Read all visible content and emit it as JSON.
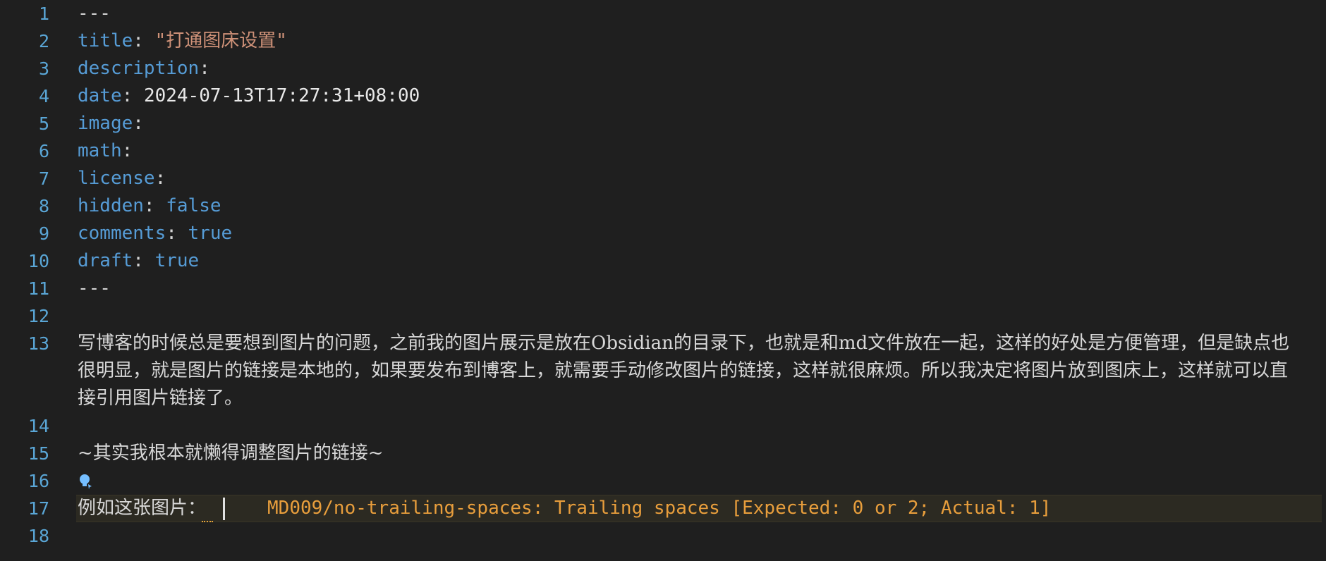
{
  "lines": [
    {
      "n": "1",
      "dash": "---"
    },
    {
      "n": "2",
      "key": "title",
      "value": "\"打通图床设置\""
    },
    {
      "n": "3",
      "key": "description"
    },
    {
      "n": "4",
      "key": "date",
      "value": "2024-07-13T17:27:31+08:00"
    },
    {
      "n": "5",
      "key": "image"
    },
    {
      "n": "6",
      "key": "math"
    },
    {
      "n": "7",
      "key": "license"
    },
    {
      "n": "8",
      "key": "hidden",
      "value": "false"
    },
    {
      "n": "9",
      "key": "comments",
      "value": "true"
    },
    {
      "n": "10",
      "key": "draft",
      "value": "true"
    },
    {
      "n": "11",
      "dash": "---"
    },
    {
      "n": "12"
    },
    {
      "n": "13",
      "prose": "写博客的时候总是要想到图片的问题，之前我的图片展示是放在Obsidian的目录下，也就是和md文件放在一起，这样的好处是方便管理，但是缺点也很明显，就是图片的链接是本地的，如果要发布到博客上，就需要手动修改图片的链接，这样就很麻烦。所以我决定将图片放到图床上，这样就可以直接引用图片链接了。"
    },
    {
      "n": "14"
    },
    {
      "n": "15",
      "prose": "~其实我根本就懒得调整图片的链接~"
    },
    {
      "n": "16"
    },
    {
      "n": "17",
      "prose": "例如这张图片：",
      "diagnostic": "MD009/no-trailing-spaces: Trailing spaces [Expected: 0 or 2; Actual: 1]"
    },
    {
      "n": "18"
    }
  ],
  "colors": {
    "background": "#1f1f1f",
    "line_numbers": "#5aa6d6",
    "yaml_key": "#569cd6",
    "string": "#ce9178",
    "diagnostic": "#e89e3c"
  }
}
